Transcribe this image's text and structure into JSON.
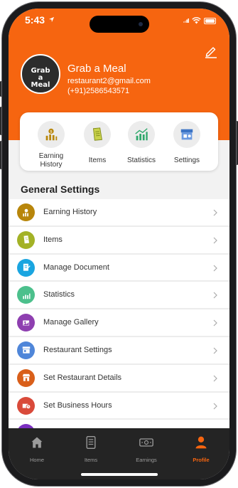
{
  "status": {
    "time": "5:43"
  },
  "profile": {
    "logo_text": "Grab a Meal",
    "name": "Grab a Meal",
    "email": "restaurant2@gmail.com",
    "phone": "(+91)2586543571"
  },
  "quick_actions": [
    {
      "label": "Earning History",
      "icon": "money-bag-icon",
      "color": "#b8860b"
    },
    {
      "label": "Items",
      "icon": "note-icon",
      "color": "#9aaa2a"
    },
    {
      "label": "Statistics",
      "icon": "bar-chart-icon",
      "color": "#2ea86b"
    },
    {
      "label": "Settings",
      "icon": "store-icon",
      "color": "#3b73c4"
    }
  ],
  "general_settings": {
    "title": "General Settings",
    "items": [
      {
        "label": "Earning History",
        "icon": "money-bag-icon",
        "color": "#b8860b"
      },
      {
        "label": "Items",
        "icon": "note-icon",
        "color": "#a3b226"
      },
      {
        "label": "Manage Document",
        "icon": "document-icon",
        "color": "#1aa5e0"
      },
      {
        "label": "Statistics",
        "icon": "bar-chart-icon",
        "color": "#4cc08c"
      },
      {
        "label": "Manage Gallery",
        "icon": "gallery-icon",
        "color": "#8e3fb0"
      },
      {
        "label": "Restaurant Settings",
        "icon": "store-icon",
        "color": "#4f86d9"
      },
      {
        "label": "Set Restaurant Details",
        "icon": "storefront-icon",
        "color": "#d95f1a"
      },
      {
        "label": "Set Business Hours",
        "icon": "clock-icon",
        "color": "#d94a3a"
      }
    ]
  },
  "tabs": [
    {
      "label": "Home",
      "icon": "home-icon",
      "active": false
    },
    {
      "label": "Items",
      "icon": "list-icon",
      "active": false
    },
    {
      "label": "Earnings",
      "icon": "cash-icon",
      "active": false
    },
    {
      "label": "Profile",
      "icon": "person-icon",
      "active": true
    }
  ],
  "colors": {
    "accent": "#f66510",
    "tabbar": "#242424"
  }
}
